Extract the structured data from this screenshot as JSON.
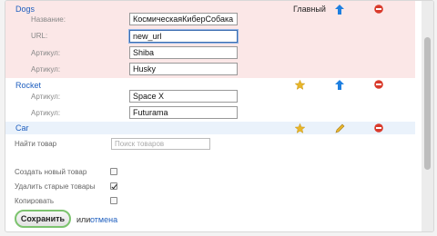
{
  "items": [
    {
      "title": "Dogs",
      "badge": "Главный",
      "fields": {
        "name_label": "Название:",
        "name_value": "КосмическаяКиберСобака",
        "url_label": "URL:",
        "url_value": "new_url",
        "sku_label_1": "Артикул:",
        "sku_value_1": "Shiba",
        "sku_label_2": "Артикул:",
        "sku_value_2": "Husky"
      }
    },
    {
      "title": "Rocket",
      "fields": {
        "sku_label_1": "Артикул:",
        "sku_value_1": "Space X",
        "sku_label_2": "Артикул:",
        "sku_value_2": "Futurama"
      }
    },
    {
      "title": "Car"
    }
  ],
  "search": {
    "label": "Найти товар",
    "placeholder": "Поиск товаров"
  },
  "options": {
    "create_label": "Создать новый товар",
    "create_checked": false,
    "delete_label": "Удалить старые товары",
    "delete_checked": true,
    "copy_label": "Копировать"
  },
  "footer": {
    "save_label": "Сохранить",
    "or_text": "или",
    "cancel_label": "отмена"
  },
  "colors": {
    "link": "#1f5fbf",
    "arrow_up": "#1e7fe0",
    "star": "#e8b62a",
    "delete": "#d93a2b",
    "highlight_row": "#fbe7e7",
    "save_border": "#7cc36e"
  },
  "icons": [
    "arrow-up-icon",
    "star-icon",
    "delete-icon",
    "pencil-icon"
  ]
}
